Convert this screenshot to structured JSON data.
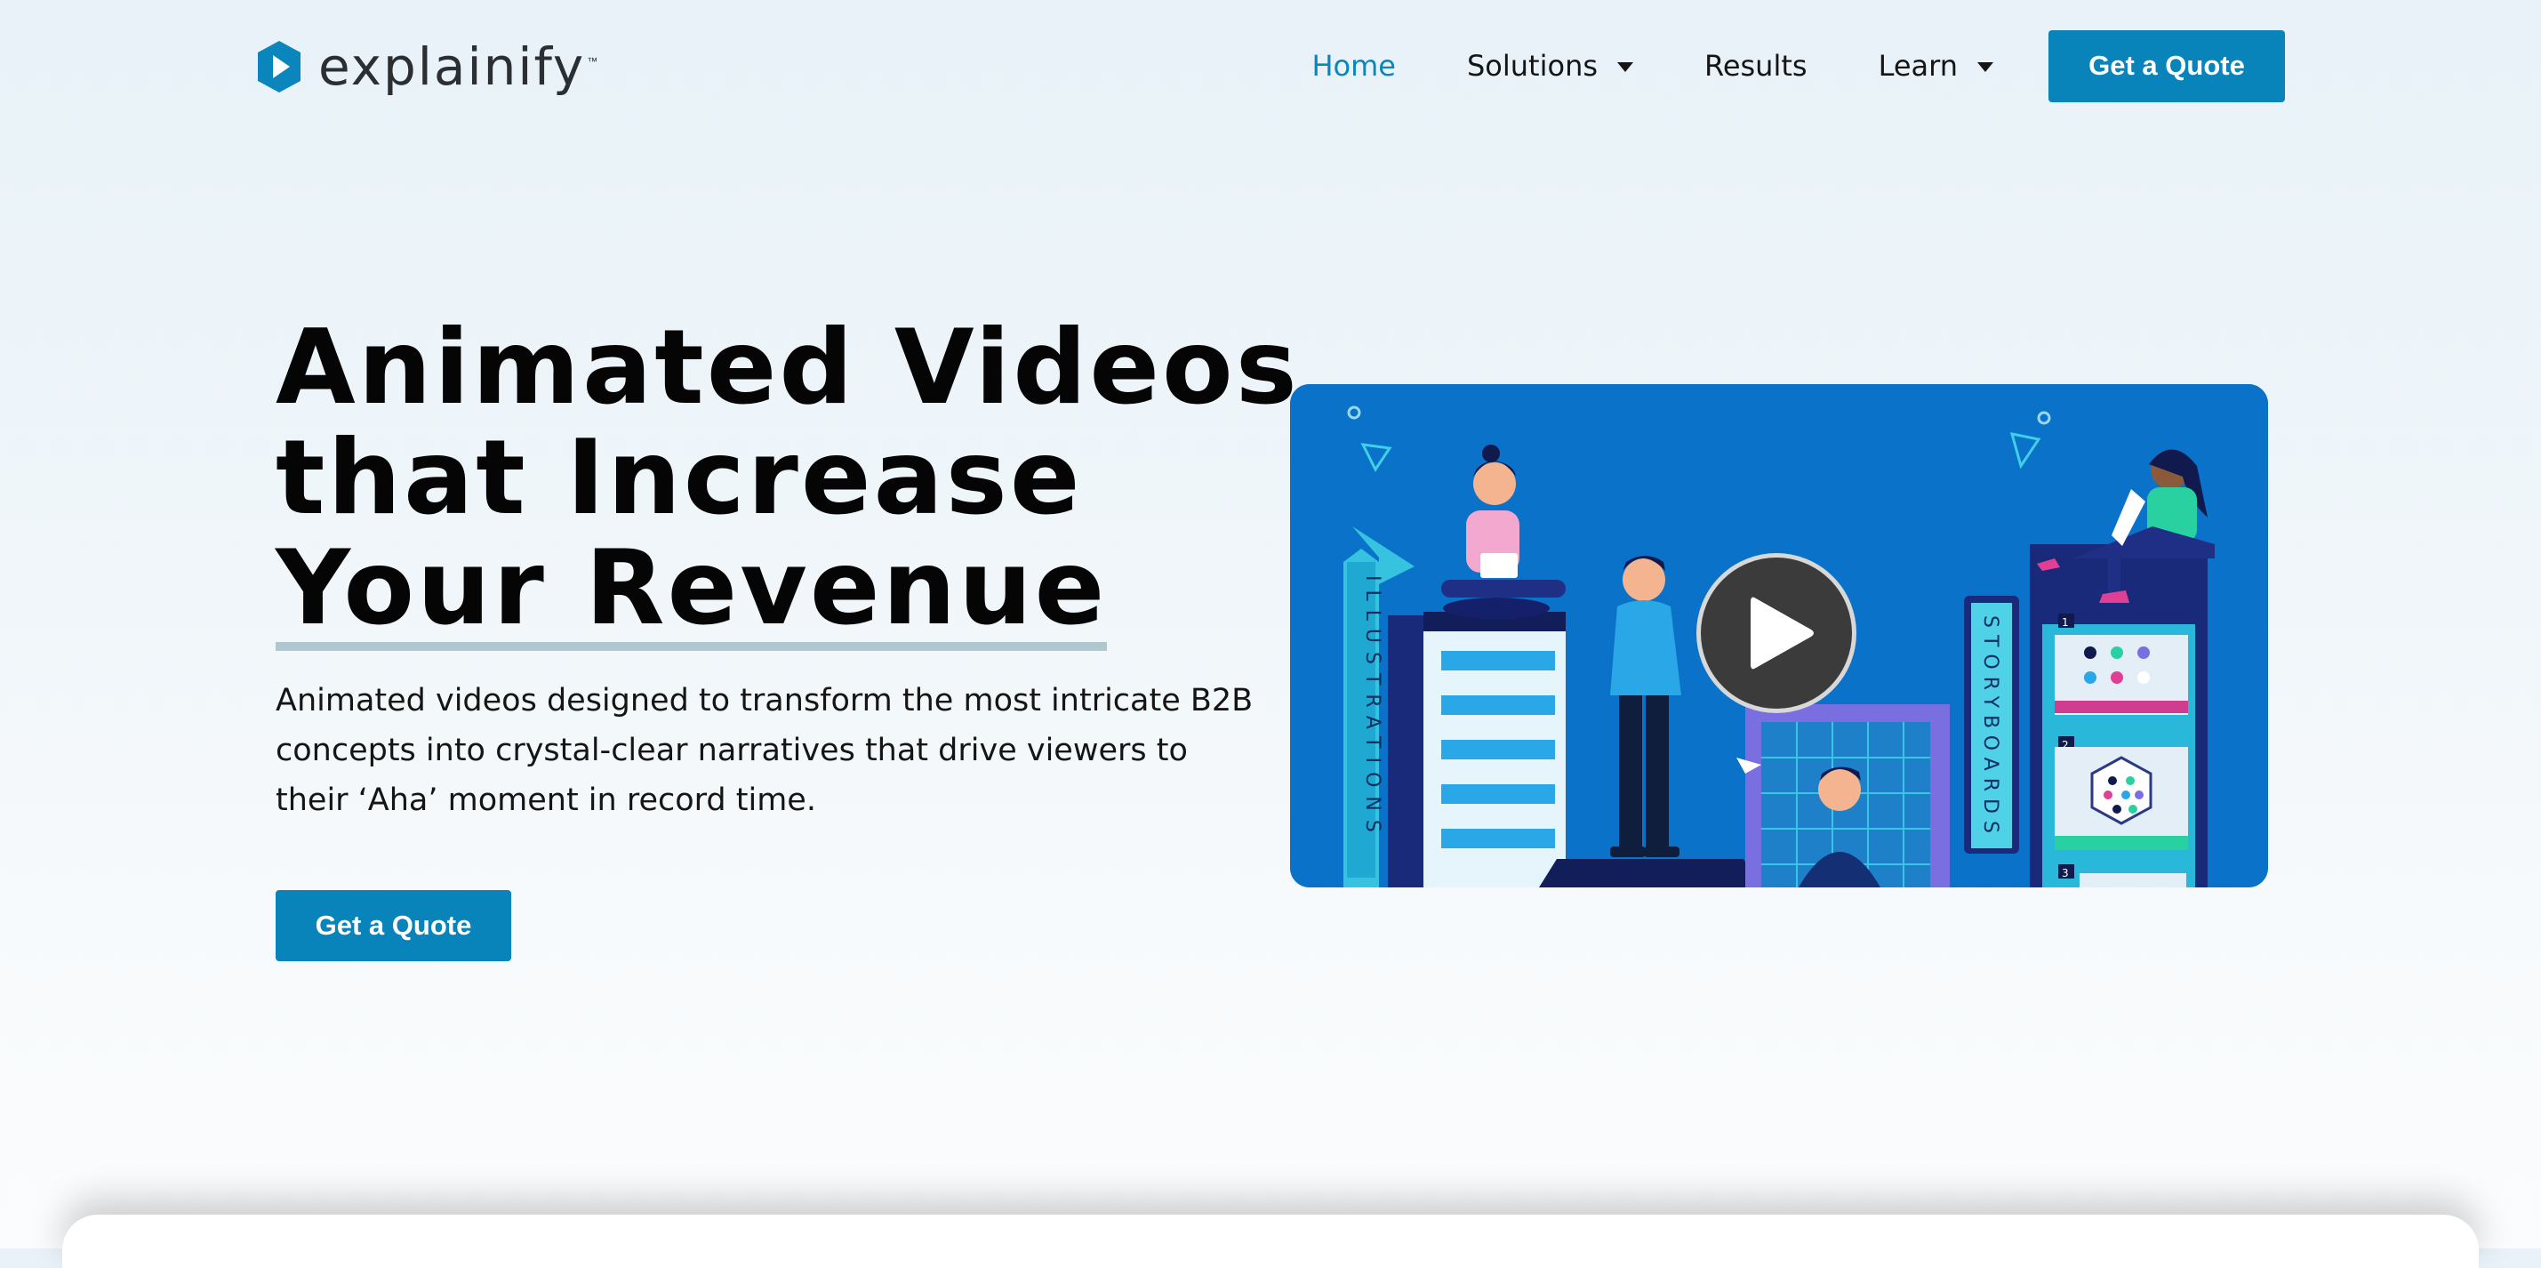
{
  "logo": {
    "text": "explainify",
    "tm": "™",
    "icon": "play-hexagon-icon"
  },
  "nav": {
    "items": [
      {
        "label": "Home",
        "active": true
      },
      {
        "label": "Solutions",
        "dropdown": true
      },
      {
        "label": "Results"
      },
      {
        "label": "Learn",
        "dropdown": true
      }
    ],
    "cta_label": "Get a Quote"
  },
  "hero": {
    "title_lines": [
      "Animated Videos",
      "that Increase",
      "Your Revenue"
    ],
    "description": "Animated videos designed to transform the most intricate B2B concepts into crystal-clear narratives that drive viewers to their ‘Aha’ moment in record time.",
    "cta_label": "Get a Quote"
  },
  "video": {
    "sign_left": "ILLUSTRATIONS",
    "sign_right": "STORYBOARDS",
    "panel_numbers": [
      "1",
      "2",
      "3"
    ],
    "play_icon": "play-icon"
  },
  "colors": {
    "accent": "#0884bb",
    "nav_active": "#0a86bd",
    "video_bg": "#0a72c8",
    "underline": "#b0c7cf"
  }
}
